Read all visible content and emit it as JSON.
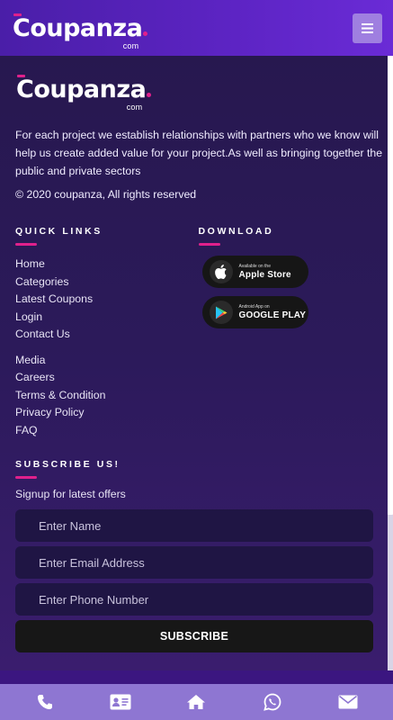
{
  "header": {
    "brand": "Coupanza",
    "brand_suffix": "com",
    "menu_icon": "hamburger-menu-icon"
  },
  "footer": {
    "brand": "Coupanza",
    "brand_suffix": "com",
    "about": "For each project we establish relationships with partners who we know will help us create added value for your project.As well as bringing together the public and private sectors",
    "copyright": "© 2020 coupanza, All rights reserved",
    "quick_links": {
      "heading": "QUICK LINKS",
      "group1": [
        "Home",
        "Categories",
        "Latest Coupons",
        "Login",
        "Contact Us"
      ],
      "group2": [
        "Media",
        "Careers",
        "Terms & Condition",
        "Privacy Policy",
        "FAQ"
      ]
    },
    "download": {
      "heading": "DOWNLOAD",
      "apple": {
        "small": "Available on the",
        "big": "Apple Store",
        "icon": "apple-icon"
      },
      "google": {
        "small": "Android App on",
        "big": "GOOGLE PLAY",
        "icon": "google-play-icon"
      }
    },
    "subscribe": {
      "heading": "SUBSCRIBE US!",
      "signup": "Signup for latest offers",
      "name_placeholder": "Enter Name",
      "email_placeholder": "Enter Email Address",
      "phone_placeholder": "Enter Phone Number",
      "button": "SUBSCRIBE"
    }
  },
  "bottom_nav": [
    "phone-icon",
    "contact-card-icon",
    "home-icon",
    "whatsapp-icon",
    "email-icon"
  ],
  "colors": {
    "accent": "#e0208c",
    "header_bg": "#5d24c4",
    "footer_bg": "#2a1b55",
    "bottom_nav_bg": "#8e76d2"
  }
}
